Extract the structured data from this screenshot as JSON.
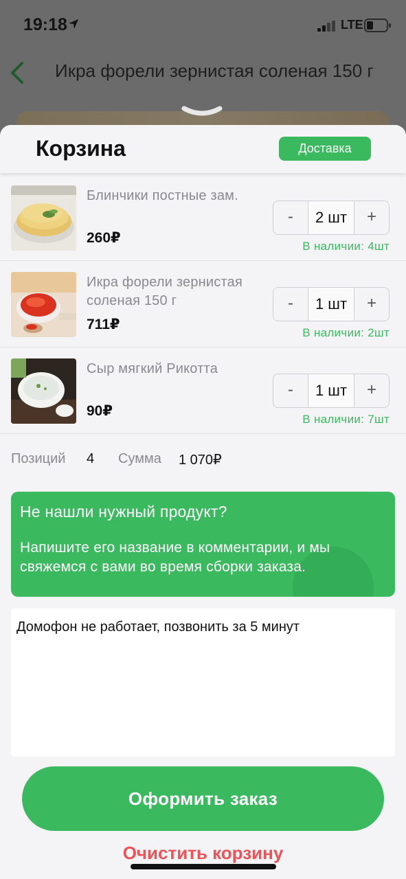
{
  "status": {
    "time": "19:18",
    "network": "LTE"
  },
  "background_page": {
    "title": "Икра форели зернистая соленая 150 г"
  },
  "sheet": {
    "title": "Корзина",
    "delivery_label": "Доставка"
  },
  "cart_items": [
    {
      "name": "Блинчики постные зам.",
      "price": "260₽",
      "quantity": "2 шт",
      "stock": "В наличии: 4шт",
      "image": "pancakes"
    },
    {
      "name": "Икра форели зернистая соленая 150 г",
      "price": "711₽",
      "quantity": "1 шт",
      "stock": "В наличии: 2шт",
      "image": "caviar"
    },
    {
      "name": "Сыр мягкий Рикотта",
      "price": "90₽",
      "quantity": "1 шт",
      "stock": "В наличии: 7шт",
      "image": "ricotta"
    }
  ],
  "stepper": {
    "minus": "-",
    "plus": "+"
  },
  "summary": {
    "positions_label": "Позиций",
    "positions_value": "4",
    "sum_label": "Сумма",
    "sum_value": "1 070₽"
  },
  "promo": {
    "title": "Не нашли нужный продукт?",
    "text": "Напишите его название в комментарии, и мы свяжемся с вами во время сборки заказа."
  },
  "comment": {
    "value": "Домофон не работает, позвонить за 5 минут"
  },
  "actions": {
    "checkout_label": "Оформить заказ",
    "clear_label": "Очистить корзину"
  },
  "colors": {
    "accent": "#3bb95f",
    "danger": "#ee5257",
    "muted": "#8a8a8e"
  },
  "icons": [
    "location-arrow-icon",
    "signal-icon",
    "battery-icon",
    "back-arrow-icon",
    "chevron-down-icon"
  ]
}
